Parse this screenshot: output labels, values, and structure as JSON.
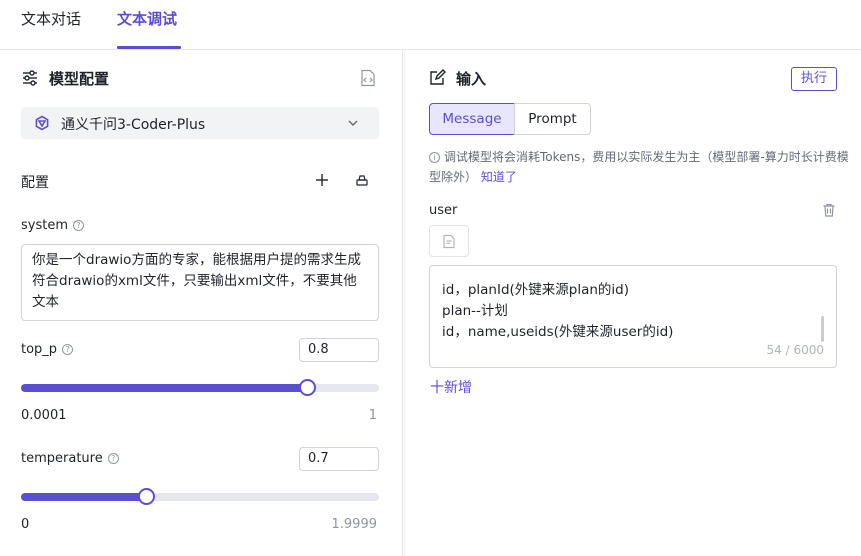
{
  "tabs": [
    {
      "label": "文本对话"
    },
    {
      "label": "文本调试"
    }
  ],
  "left": {
    "section_title": "模型配置",
    "model_name": "通义千问3-Coder-Plus",
    "config_title": "配置",
    "system": {
      "label": "system",
      "value": "你是一个drawio方面的专家，能根据用户提的需求生成符合drawio的xml文件，只要输出xml文件，不要其他文本"
    },
    "top_p": {
      "label": "top_p",
      "value": "0.8",
      "min": "0.0001",
      "max": "1",
      "fill_fraction": 0.8
    },
    "temperature": {
      "label": "temperature",
      "value": "0.7",
      "min": "0",
      "max": "1.9999",
      "fill_fraction": 0.35
    }
  },
  "right": {
    "section_title": "输入",
    "run_button": "执行",
    "seg_tabs": [
      "Message",
      "Prompt"
    ],
    "notice_text": "调试模型将会消耗Tokens，费用以实际发生为主（模型部署-算力时长计费模型除外）",
    "notice_link": "知道了",
    "role_label": "user",
    "message_lines": [
      "id，planId(外键来源plan的id)",
      "plan--计划",
      "id，name,useids(外键来源user的id)"
    ],
    "char_count": "54 / 6000",
    "add_label": "十新增"
  },
  "colors": {
    "accent": "#5b4fd1",
    "border": "#d0d3d9",
    "muted": "#646a73"
  }
}
